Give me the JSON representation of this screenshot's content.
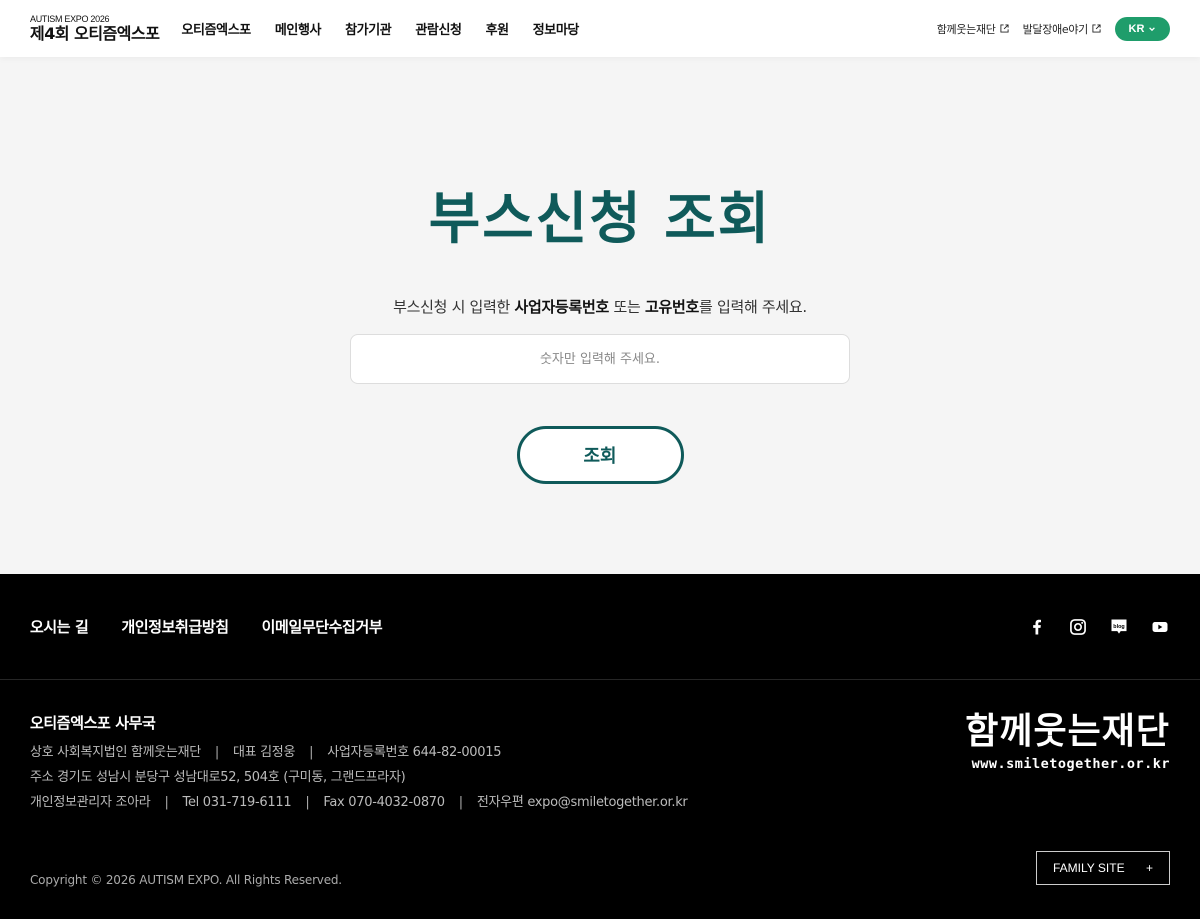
{
  "header": {
    "logo_sub": "AUTISM EXPO 2026",
    "logo_main": "제4회 오티즘엑스포",
    "nav": [
      "오티즘엑스포",
      "메인행사",
      "참가기관",
      "관람신청",
      "후원",
      "정보마당"
    ],
    "ext_links": [
      "함께웃는재단",
      "발달장애e야기"
    ],
    "lang": "KR"
  },
  "main": {
    "title": "부스신청 조회",
    "instruction_pre": "부스신청 시 입력한 ",
    "instruction_b1": "사업자등록번호",
    "instruction_mid": " 또는 ",
    "instruction_b2": "고유번호",
    "instruction_post": "를 입력해 주세요.",
    "input_placeholder": "숫자만 입력해 주세요.",
    "button_label": "조회"
  },
  "footer": {
    "links": [
      "오시는 길",
      "개인정보취급방침",
      "이메일무단수집거부"
    ],
    "social_icons": [
      "facebook-icon",
      "instagram-icon",
      "blog-icon",
      "youtube-icon"
    ],
    "office_title": "오티즘엑스포 사무국",
    "line1": [
      "상호 사회복지법인 함께웃는재단",
      "대표 김정웅",
      "사업자등록번호 644-82-00015"
    ],
    "line2": "주소 경기도 성남시 분당구 성남대로52, 504호 (구미동, 그랜드프라자)",
    "line3": [
      "개인정보관리자 조아라",
      "Tel 031-719-6111",
      "Fax 070-4032-0870",
      "전자우편 expo@smiletogether.or.kr"
    ],
    "copyright": "Copyright © 2026 AUTISM EXPO. All Rights Reserved.",
    "org_logo_text": "함께웃는재단",
    "org_logo_url": "www.smiletogether.or.kr",
    "family_site": "FAMILY SITE",
    "family_plus": "+"
  },
  "colors": {
    "brand_green": "#1f9d6b",
    "title_teal": "#0f5a5a",
    "footer_bg": "#000000"
  }
}
